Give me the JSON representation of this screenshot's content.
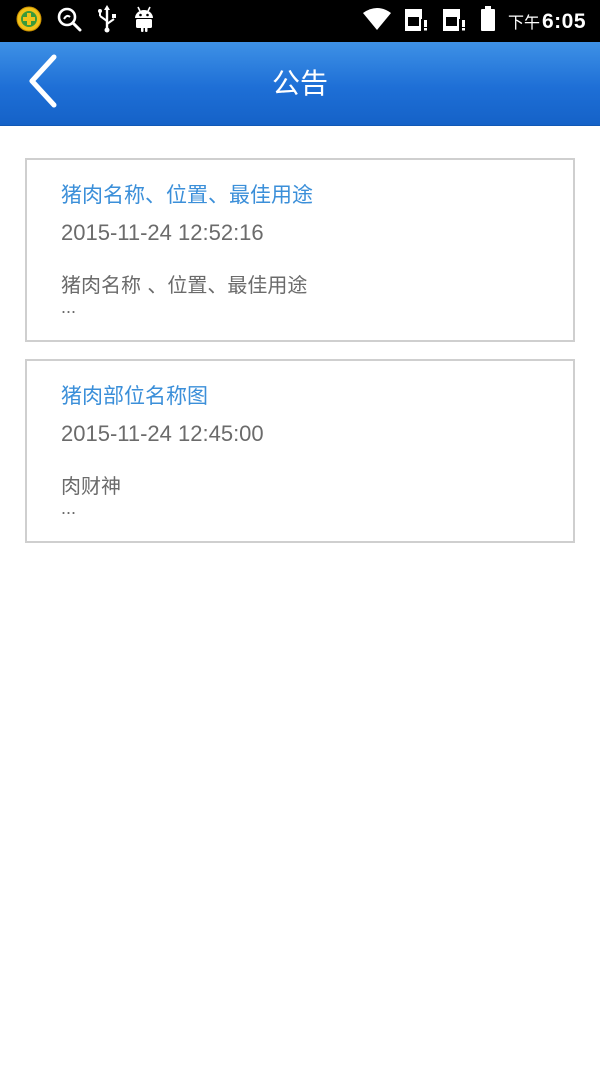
{
  "status_bar": {
    "time_ampm": "下午",
    "time": "6:05",
    "icons_left": [
      "app-badge-icon",
      "search-icon",
      "usb-icon",
      "android-icon"
    ],
    "icons_right": [
      "wifi-icon",
      "sim1-icon",
      "sim2-icon",
      "battery-icon"
    ]
  },
  "header": {
    "title": "公告",
    "back_icon": "chevron-left-icon"
  },
  "announcements": [
    {
      "title": "猪肉名称、位置、最佳用途",
      "date": "2015-11-24 12:52:16",
      "summary": "猪肉名称 、位置、最佳用途",
      "ellipsis": "..."
    },
    {
      "title": "猪肉部位名称图",
      "date": "2015-11-24 12:45:00",
      "summary": "肉财神",
      "ellipsis": "..."
    }
  ],
  "colors": {
    "header_bg": "#1e6fd6",
    "title_link": "#3b8fd9",
    "meta_text": "#6b6b6b",
    "card_border": "#cfcfcf"
  }
}
